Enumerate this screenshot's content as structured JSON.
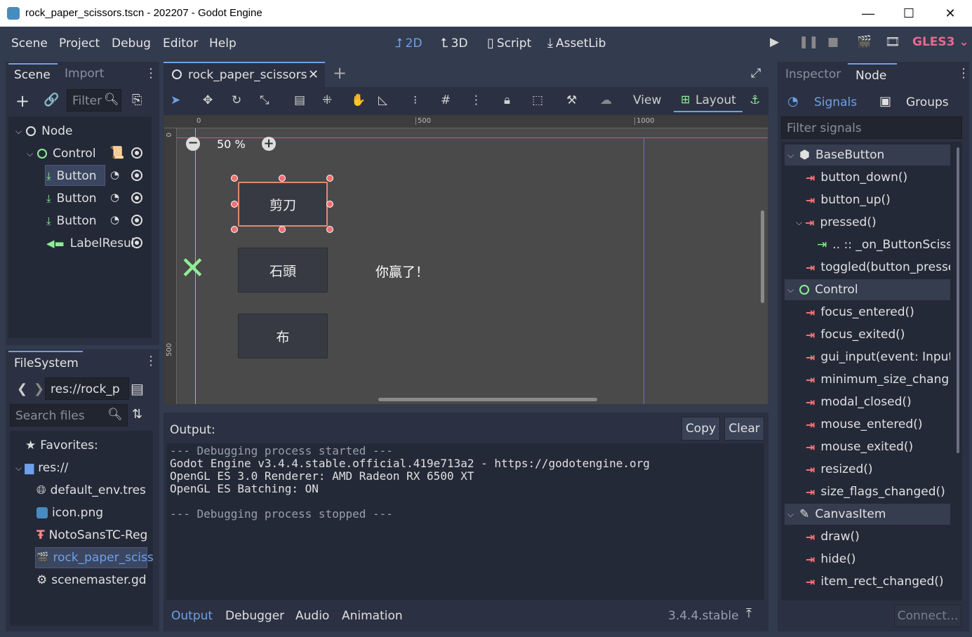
{
  "window": {
    "title": "rock_paper_scissors.tscn - 202207 - Godot Engine",
    "minimize": "—",
    "maximize": "☐",
    "close": "✕"
  },
  "menu": [
    "Scene",
    "Project",
    "Debug",
    "Editor",
    "Help"
  ],
  "workspaces": [
    {
      "label": "2D",
      "icon": "2d-icon",
      "glyph": "⮥"
    },
    {
      "label": "3D",
      "icon": "3d-icon",
      "glyph": "⮤"
    },
    {
      "label": "Script",
      "icon": "script-icon",
      "glyph": "▯"
    },
    {
      "label": "AssetLib",
      "icon": "assetlib-icon",
      "glyph": "⤓"
    }
  ],
  "renderer": "GLES3",
  "scene_dock": {
    "tabs": [
      "Scene",
      "Import"
    ],
    "filter_placeholder": "Filter",
    "tree": [
      {
        "label": "Node",
        "indent": 0
      },
      {
        "label": "Control",
        "indent": 1
      },
      {
        "label": "Button",
        "indent": 2,
        "selected": true
      },
      {
        "label": "Button",
        "indent": 2
      },
      {
        "label": "Button",
        "indent": 2
      },
      {
        "label": "LabelResul",
        "indent": 2
      }
    ]
  },
  "filesystem": {
    "tab": "FileSystem",
    "path": "res://rock_p",
    "search_placeholder": "Search files",
    "items": [
      "Favorites:",
      "res://",
      "default_env.tres",
      "icon.png",
      "NotoSansTC-Reg",
      "rock_paper_sciss",
      "scenemaster.gd"
    ]
  },
  "editor": {
    "scene_tab": "rock_paper_scissors",
    "view_label": "View",
    "layout_label": "Layout",
    "zoom": "50 %",
    "ruler": [
      "0",
      "500",
      "1000"
    ],
    "vruler": [
      "0",
      "500"
    ],
    "buttons": [
      "剪刀",
      "石頭",
      "布"
    ],
    "result_label": "你贏了！"
  },
  "output": {
    "title": "Output:",
    "copy": "Copy",
    "clear": "Clear",
    "lines": [
      "--- Debugging process started ---",
      "Godot Engine v3.4.4.stable.official.419e713a2 - https://godotengine.org",
      "OpenGL ES 3.0 Renderer: AMD Radeon RX 6500 XT",
      "OpenGL ES Batching: ON",
      "",
      "--- Debugging process stopped ---"
    ],
    "bottom_tabs": [
      "Output",
      "Debugger",
      "Audio",
      "Animation"
    ],
    "version": "3.4.4.stable"
  },
  "inspector": {
    "tabs": [
      "Inspector",
      "Node"
    ],
    "subtabs": [
      "Signals",
      "Groups"
    ],
    "filter_placeholder": "Filter signals",
    "categories": {
      "base_button": "BaseButton",
      "control": "Control",
      "canvas_item": "CanvasItem"
    },
    "signals_base": [
      "button_down()",
      "button_up()",
      "pressed()",
      ".. :: _on_ButtonSciss",
      "toggled(button_presse"
    ],
    "signals_control": [
      "focus_entered()",
      "focus_exited()",
      "gui_input(event: Input",
      "minimum_size_chang",
      "modal_closed()",
      "mouse_entered()",
      "mouse_exited()",
      "resized()",
      "size_flags_changed()"
    ],
    "signals_canvas": [
      "draw()",
      "hide()",
      "item_rect_changed()"
    ],
    "connect": "Connect..."
  },
  "colors": {
    "accent": "#6ea1e8",
    "bg": "#333b4f",
    "panel": "#242938",
    "selected": "#3b4660",
    "signal": "#ff7676",
    "node_green": "#8eef97"
  }
}
